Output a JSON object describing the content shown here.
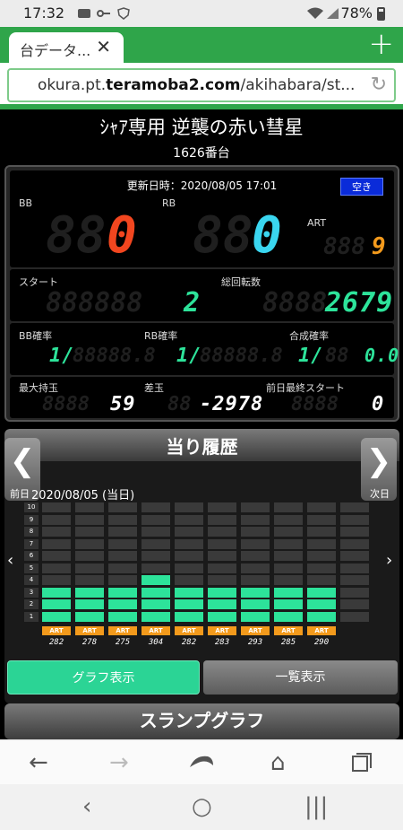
{
  "status": {
    "time": "17:32",
    "battery": "78%"
  },
  "browser": {
    "tab_title": "台データ...",
    "url_prefix": "okura.pt.",
    "url_domain": "teramoba2.com",
    "url_suffix": "/akihabara/st..."
  },
  "machine": {
    "name": "ｼｬｱ専用 逆襲の赤い彗星",
    "number": "1626番台"
  },
  "stats": {
    "updated": "更新日時：2020/08/05 17:01",
    "status_badge": "空き",
    "bb_label": "BB",
    "bb_value": "0",
    "rb_label": "RB",
    "rb_value": "0",
    "art_label": "ART",
    "art_value": "9",
    "start_label": "スタート",
    "start_value": "2",
    "total_spins_label": "総回転数",
    "total_spins_value": "2679",
    "bb_prob_label": "BB確率",
    "bb_prob_value": "1/",
    "rb_prob_label": "RB確率",
    "rb_prob_value": "1/",
    "combined_prob_label": "合成確率",
    "combined_prob_value": "1/",
    "combined_prob_decimal": "0.0",
    "max_balls_label": "最大持玉",
    "max_balls_value": "59",
    "diff_label": "差玉",
    "diff_value": "-2978",
    "prev_day_start_label": "前日最終スタート",
    "prev_day_start_value": "0"
  },
  "history": {
    "title": "当り履歴",
    "prev_label": "前日",
    "next_label": "次日",
    "date": "2020/08/05 (当日)",
    "levels": [
      "10",
      "9",
      "8",
      "7",
      "6",
      "5",
      "4",
      "3",
      "2",
      "1"
    ],
    "columns": [
      {
        "type": "ART",
        "value": "282",
        "level": 3
      },
      {
        "type": "ART",
        "value": "278",
        "level": 3
      },
      {
        "type": "ART",
        "value": "275",
        "level": 3
      },
      {
        "type": "ART",
        "value": "304",
        "level": 4
      },
      {
        "type": "ART",
        "value": "282",
        "level": 3
      },
      {
        "type": "ART",
        "value": "283",
        "level": 3
      },
      {
        "type": "ART",
        "value": "293",
        "level": 3
      },
      {
        "type": "ART",
        "value": "285",
        "level": 3
      },
      {
        "type": "ART",
        "value": "290",
        "level": 3
      },
      {
        "type": "",
        "value": "",
        "level": 0
      }
    ],
    "graph_button": "グラフ表示",
    "list_button": "一覧表示"
  },
  "slump_title": "スランプグラフ",
  "colors": {
    "bar_on": "#2de39a",
    "bar_off": "#3a3a3a",
    "art_badge": "#f39a1c"
  }
}
